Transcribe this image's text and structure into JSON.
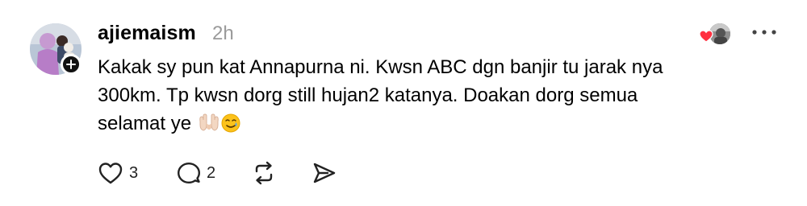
{
  "post": {
    "author": {
      "username": "ajiemaism",
      "avatar_icon": "avatar-photo",
      "follow_icon": "plus-icon"
    },
    "timestamp": "2h",
    "text_lines": [
      "Kakak sy pun kat Annapurna ni. Kwsn ABC dgn banjir tu jarak nya",
      "300km. Tp kwsn dorg still hujan2 katanya. Doakan dorg semua",
      "selamat ye"
    ],
    "emojis": [
      "palms-up-together",
      "smiling-face-with-tear"
    ],
    "liked_by_icons": [
      "heart-icon",
      "liker-avatar"
    ],
    "more_icon": "more-horizontal-icon",
    "actions": {
      "like": {
        "icon": "heart-outline-icon",
        "count": "3"
      },
      "reply": {
        "icon": "speech-bubble-icon",
        "count": "2"
      },
      "repost": {
        "icon": "repost-icon"
      },
      "share": {
        "icon": "send-icon"
      }
    },
    "colors": {
      "text": "#000000",
      "muted": "#9a9a9a",
      "heart": "#ff3040",
      "icon": "#222222"
    }
  }
}
